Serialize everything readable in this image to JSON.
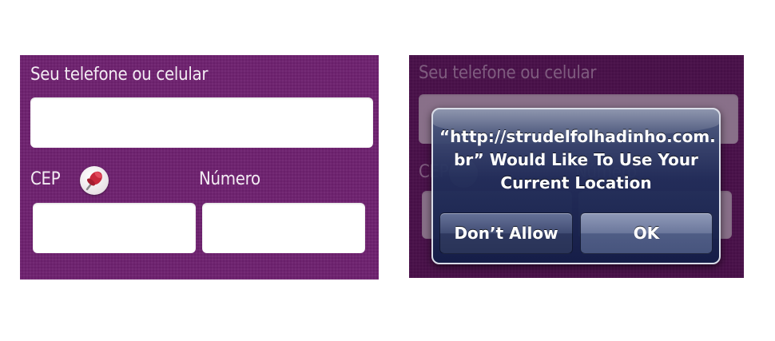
{
  "form": {
    "phone_label": "Seu telefone ou celular",
    "cep_label": "CEP",
    "numero_label": "Número",
    "phone_value": "",
    "cep_value": "",
    "numero_value": "",
    "pin_icon": "pushpin-icon"
  },
  "alert": {
    "message": "“http://strudelfolhadinho.com.br” Would Like To Use Your Current Location",
    "message_lines": [
      "“http://strudelfolhadinho.com.",
      "br” Would Like To Use Your",
      "Current Location"
    ],
    "dont_allow_label": "Don’t Allow",
    "ok_label": "OK"
  },
  "colors": {
    "panel_purple": "#6f2170",
    "alert_blue": "#223466",
    "field_white": "#ffffff"
  }
}
